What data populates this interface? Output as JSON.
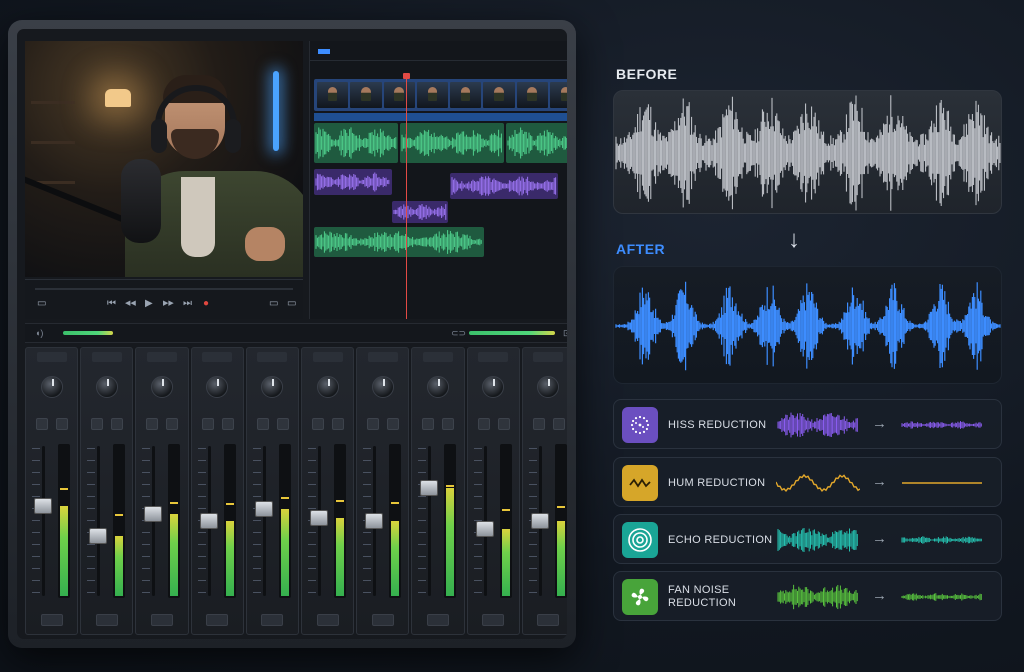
{
  "comparison": {
    "before_label": "BEFORE",
    "after_label": "AFTER",
    "arrow": "↓"
  },
  "features": [
    {
      "name": "HISS REDUCTION",
      "icon": "sparkle-dots-icon",
      "color": "#6b4fc0",
      "wave_color": "#8a5cf0"
    },
    {
      "name": "HUM REDUCTION",
      "icon": "zigzag-wave-icon",
      "color": "#d6a629",
      "wave_color": "#e2a72b"
    },
    {
      "name": "ECHO REDUCTION",
      "icon": "concentric-rings-icon",
      "color": "#1aa596",
      "wave_color": "#25c1b0"
    },
    {
      "name": "FAN NOISE REDUCTION",
      "icon": "fan-icon",
      "color": "#48a43a",
      "wave_color": "#58c23e"
    }
  ],
  "feature_arrow": "→",
  "editor": {
    "transport_icons": [
      "skip-back-icon",
      "rewind-icon",
      "play-icon",
      "fast-forward-icon",
      "skip-forward-icon",
      "record-icon"
    ],
    "transport_glyphs": [
      "⏮",
      "◀◀",
      "▶",
      "▶▶",
      "⏭",
      "●"
    ],
    "mixer_channels": [
      {
        "level": 0.6,
        "peak": 0.72
      },
      {
        "level": 0.4,
        "peak": 0.55
      },
      {
        "level": 0.55,
        "peak": 0.63
      },
      {
        "level": 0.5,
        "peak": 0.62
      },
      {
        "level": 0.58,
        "peak": 0.66
      },
      {
        "level": 0.52,
        "peak": 0.64
      },
      {
        "level": 0.5,
        "peak": 0.63
      },
      {
        "level": 0.72,
        "peak": 0.74
      },
      {
        "level": 0.45,
        "peak": 0.58
      },
      {
        "level": 0.5,
        "peak": 0.6
      }
    ]
  },
  "colors": {
    "before_wave": "#c9ccd2",
    "after_wave": "#3d8dff",
    "after_label": "#3d8dff",
    "timeline_green": "#3fbd79",
    "timeline_purple": "#7b52d6",
    "playhead": "#e24a45"
  }
}
